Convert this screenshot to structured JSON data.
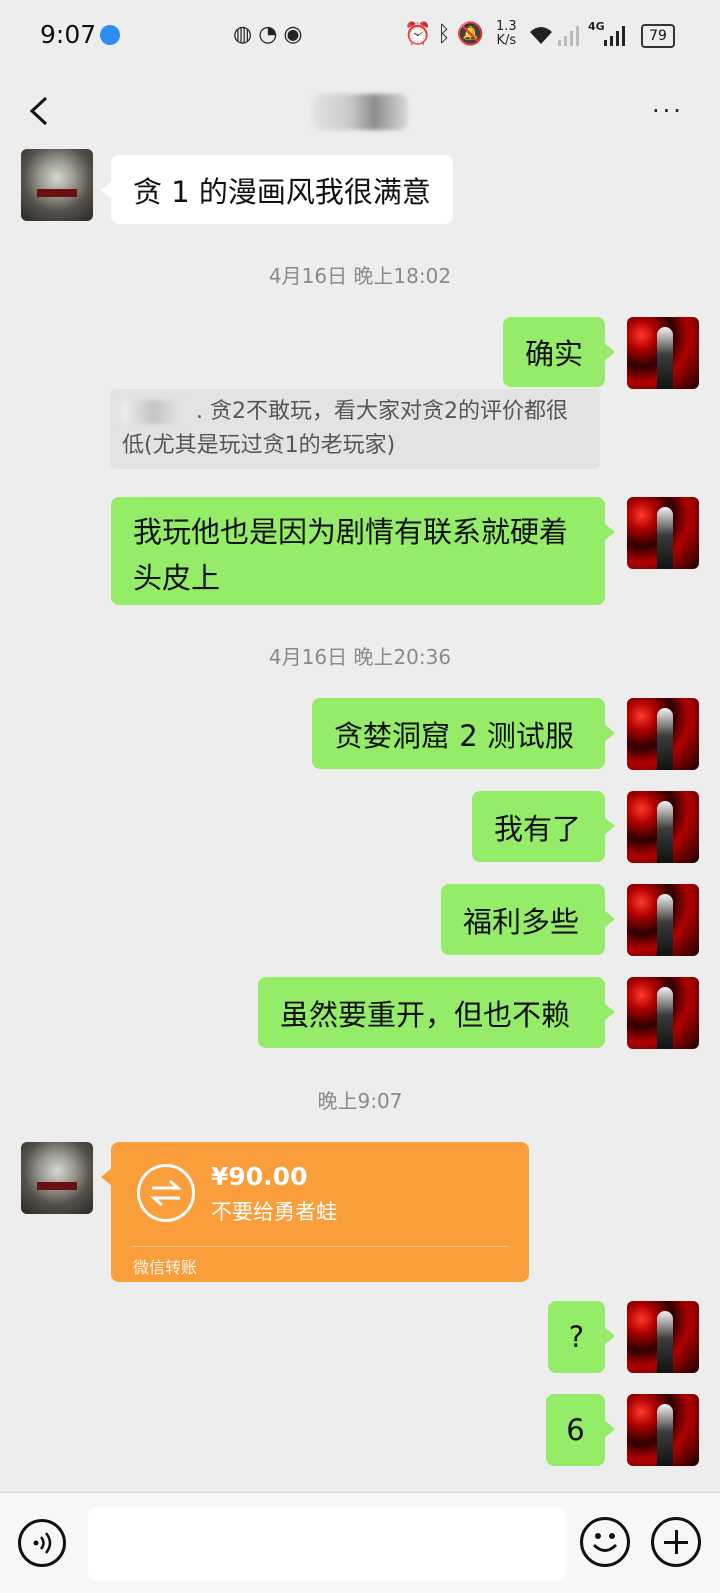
{
  "status_bar": {
    "time": "9:07",
    "net_speed_value": "1.3",
    "net_speed_unit": "K/s",
    "battery": "79",
    "network_label": "4G"
  },
  "chat": {
    "more_label": "···",
    "messages": [
      {
        "type": "text",
        "side": "left",
        "text": "贪 1 的漫画风我很满意"
      },
      {
        "type": "timestamp",
        "text": "4月16日 晚上18:02"
      },
      {
        "type": "text",
        "side": "right",
        "text": "确实"
      },
      {
        "type": "quote",
        "text": "贪2不敢玩，看大家对贪2的评价都很低(尤其是玩过贪1的老玩家)",
        "prefix": "."
      },
      {
        "type": "text",
        "side": "right",
        "text": "我玩他也是因为剧情有联系就硬着头皮上"
      },
      {
        "type": "timestamp",
        "text": "4月16日 晚上20:36"
      },
      {
        "type": "text",
        "side": "right",
        "text": "贪婪洞窟 2 测试服"
      },
      {
        "type": "text",
        "side": "right",
        "text": "我有了"
      },
      {
        "type": "text",
        "side": "right",
        "text": "福利多些"
      },
      {
        "type": "text",
        "side": "right",
        "text": "虽然要重开，但也不赖"
      },
      {
        "type": "timestamp",
        "text": "晚上9:07"
      },
      {
        "type": "transfer",
        "side": "left",
        "amount": "¥90.00",
        "note": "不要给勇者蛙",
        "label": "微信转账"
      },
      {
        "type": "text",
        "side": "right",
        "text": "?"
      },
      {
        "type": "text",
        "side": "right",
        "text": "6"
      }
    ]
  },
  "colors": {
    "background": "#ededed",
    "bubble_green": "#95ec69",
    "bubble_white": "#ffffff",
    "transfer_orange": "#fa9d3b"
  },
  "icons": [
    "back-arrow-icon",
    "more-icon",
    "voice-icon",
    "emoji-icon",
    "plus-icon",
    "transfer-icon"
  ]
}
